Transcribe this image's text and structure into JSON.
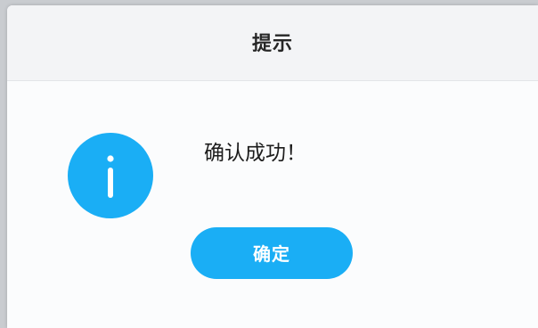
{
  "dialog": {
    "title": "提示",
    "message": "确认成功！",
    "confirm_label": "确定",
    "icon": "info-icon"
  },
  "colors": {
    "accent": "#1aaef5",
    "header_background": "#f3f4f6",
    "dialog_background": "#fbfcfd",
    "text": "#1c1c1c"
  }
}
